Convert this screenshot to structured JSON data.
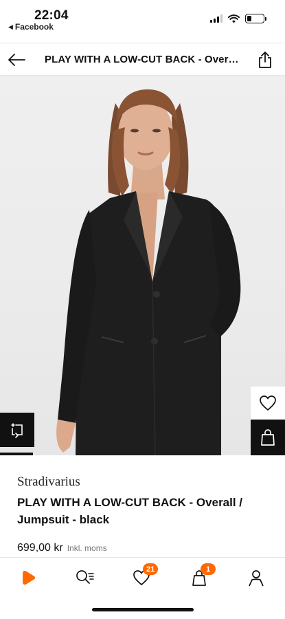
{
  "status_bar": {
    "time": "22:04",
    "back_app": "Facebook",
    "battery_level": 0.25
  },
  "header": {
    "title": "PLAY WITH A LOW-CUT BACK - Overall / Jumpsuit - black",
    "back_icon": "arrow-left-icon",
    "share_icon": "share-icon"
  },
  "image_overlay": {
    "wishlist_icon": "heart-icon",
    "add_to_bag_icon": "shopping-bag-icon",
    "size_icon": "size-guide-icon"
  },
  "product": {
    "brand": "Stradivarius",
    "name": "PLAY WITH A LOW-CUT BACK - Overall / Jumpsuit - black",
    "price": "699,00 kr",
    "tax_note": "Inkl. moms"
  },
  "bottom_nav": {
    "items": [
      {
        "icon": "home-icon"
      },
      {
        "icon": "search-icon"
      },
      {
        "icon": "wishlist-icon",
        "badge": "21"
      },
      {
        "icon": "bag-icon",
        "badge": "1"
      },
      {
        "icon": "profile-icon"
      }
    ]
  },
  "colors": {
    "accent": "#ff6900",
    "text": "#111111",
    "background": "#ffffff"
  }
}
